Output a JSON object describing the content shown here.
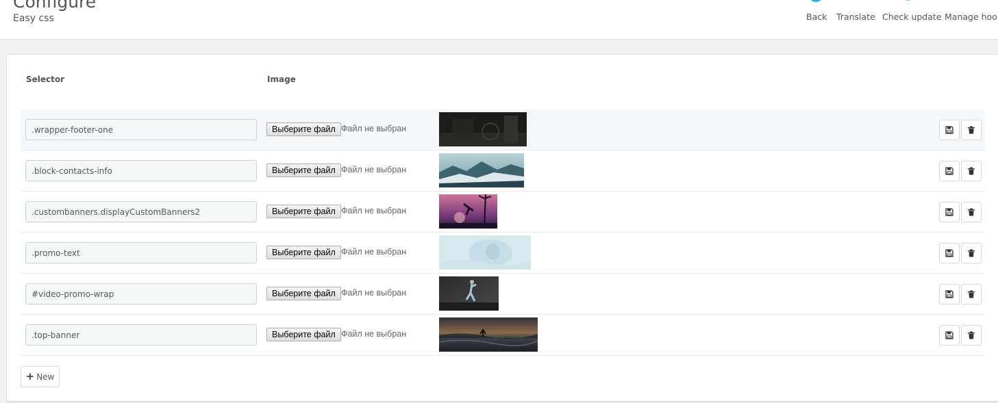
{
  "header": {
    "title": "Configure",
    "subtitle": "Easy css",
    "toolbar": [
      {
        "label": "Back",
        "icon": "arrow-left-circle-icon"
      },
      {
        "label": "Translate",
        "icon": "flag-icon"
      },
      {
        "label": "Check update",
        "icon": "refresh-icon"
      },
      {
        "label": "Manage hooks",
        "icon": "anchor-icon"
      }
    ]
  },
  "table": {
    "columns": {
      "selector": "Selector",
      "image": "Image"
    },
    "file_button_label": "Выберите файл",
    "file_status": "Файл не выбран",
    "rows": [
      {
        "selector": ".wrapper-footer-one"
      },
      {
        "selector": ".block-contacts-info"
      },
      {
        "selector": ".custombanners.displayCustomBanners2"
      },
      {
        "selector": ".promo-text"
      },
      {
        "selector": "#video-promo-wrap"
      },
      {
        "selector": ".top-banner"
      }
    ]
  },
  "new_button": {
    "label": "New",
    "icon": "plus-icon"
  },
  "colors": {
    "accent": "#25b9d7",
    "row_alt": "#f4f7f9"
  }
}
